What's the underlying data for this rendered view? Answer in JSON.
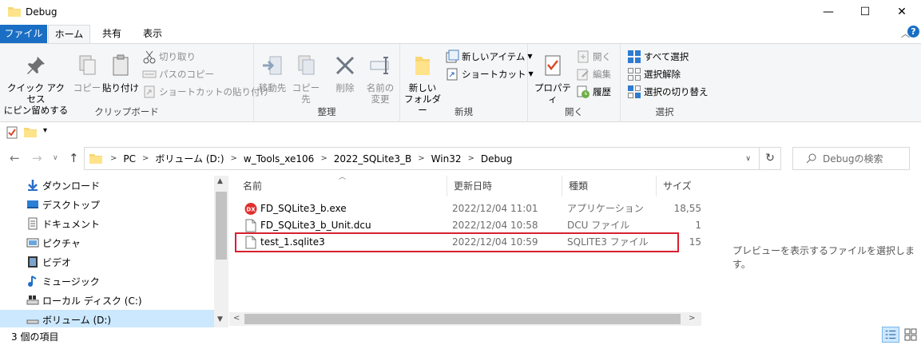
{
  "window": {
    "title": "Debug",
    "controls": {
      "minimize": "—",
      "maximize": "☐",
      "close": "✕"
    }
  },
  "ribbon_tabs": {
    "file": "ファイル",
    "home": "ホーム",
    "share": "共有",
    "view": "表示"
  },
  "ribbon": {
    "clipboard": {
      "label": "クリップボード",
      "pin_quick_access": [
        "クイック アクセス",
        "にピン留めする"
      ],
      "copy": "コピー",
      "paste": "貼り付け",
      "cut": "切り取り",
      "copy_path": "パスのコピー",
      "paste_shortcut": "ショートカットの貼り付け"
    },
    "organize": {
      "label": "整理",
      "move_to": "移動先",
      "copy_to": "コピー先",
      "delete": "削除",
      "rename": [
        "名前の",
        "変更"
      ]
    },
    "new": {
      "label": "新規",
      "new_folder": [
        "新しい",
        "フォルダー"
      ],
      "new_item": "新しいアイテム",
      "shortcut": "ショートカット"
    },
    "open": {
      "label": "開く",
      "properties": "プロパティ",
      "open": "開く",
      "edit": "編集",
      "history": "履歴"
    },
    "select": {
      "label": "選択",
      "select_all": "すべて選択",
      "select_none": "選択解除",
      "invert": "選択の切り替え"
    }
  },
  "address": {
    "crumbs": [
      "PC",
      "ボリューム (D:)",
      "w_Tools_xe106",
      "2022_SQLite3_B",
      "Win32",
      "Debug"
    ],
    "search_placeholder": "Debugの検索"
  },
  "nav_pane": {
    "items": [
      {
        "label": "ダウンロード",
        "icon": "download-icon"
      },
      {
        "label": "デスクトップ",
        "icon": "desktop-icon"
      },
      {
        "label": "ドキュメント",
        "icon": "documents-icon"
      },
      {
        "label": "ピクチャ",
        "icon": "pictures-icon"
      },
      {
        "label": "ビデオ",
        "icon": "video-icon"
      },
      {
        "label": "ミュージック",
        "icon": "music-icon"
      },
      {
        "label": "ローカル ディスク (C:)",
        "icon": "drive-icon"
      },
      {
        "label": "ボリューム (D:)",
        "icon": "drive-icon"
      }
    ]
  },
  "file_list": {
    "columns": {
      "name": "名前",
      "modified": "更新日時",
      "type": "種類",
      "size": "サイズ"
    },
    "rows": [
      {
        "name": "FD_SQLite3_b.exe",
        "modified": "2022/12/04 11:01",
        "type": "アプリケーション",
        "size": "18,55",
        "icon": "exe-icon"
      },
      {
        "name": "FD_SQLite3_b_Unit.dcu",
        "modified": "2022/12/04 10:58",
        "type": "DCU ファイル",
        "size": "1",
        "icon": "file-icon"
      },
      {
        "name": "test_1.sqlite3",
        "modified": "2022/12/04 10:59",
        "type": "SQLITE3 ファイル",
        "size": "15",
        "icon": "file-icon"
      }
    ]
  },
  "preview": {
    "message": "プレビューを表示するファイルを選択します。"
  },
  "status": {
    "item_count": "3 個の項目"
  },
  "colors": {
    "accent": "#1a6fc4",
    "selection": "#cce8ff",
    "highlight_box": "#d8202d"
  }
}
